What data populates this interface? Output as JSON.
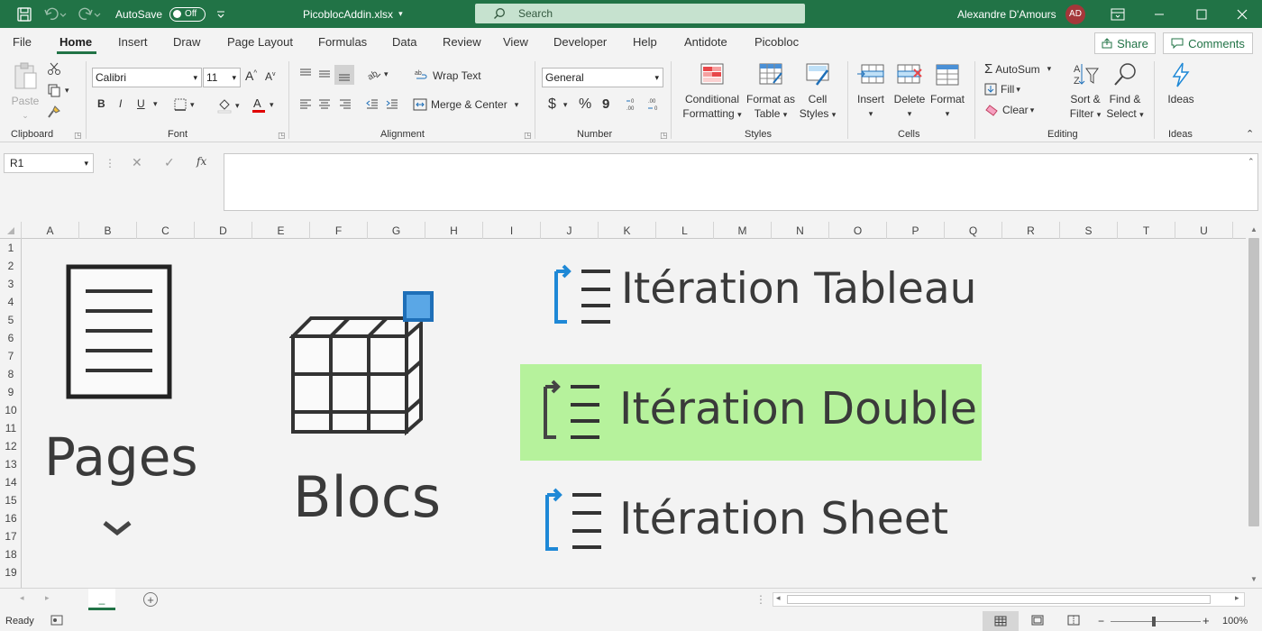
{
  "titlebar": {
    "autosave_label": "AutoSave",
    "autosave_state": "Off",
    "filename": "PicoblocAddin.xlsx",
    "search_placeholder": "Search",
    "user_name": "Alexandre D'Amours",
    "user_initials": "AD",
    "bg_color": "#217346"
  },
  "menu": {
    "items": [
      "File",
      "Home",
      "Insert",
      "Draw",
      "Page Layout",
      "Formulas",
      "Data",
      "Review",
      "View",
      "Developer",
      "Help",
      "Antidote",
      "Picobloc"
    ],
    "active": "Home",
    "share_label": "Share",
    "comments_label": "Comments"
  },
  "ribbon": {
    "clipboard": {
      "paste_label": "Paste",
      "group_label": "Clipboard"
    },
    "font": {
      "font_name": "Calibri",
      "font_size": "11",
      "bold": "B",
      "italic": "I",
      "underline": "U",
      "group_label": "Font"
    },
    "alignment": {
      "wrap_text": "Wrap Text",
      "merge_center": "Merge & Center",
      "group_label": "Alignment"
    },
    "number": {
      "format": "General",
      "currency": "$",
      "percent": "%",
      "comma": "9",
      "group_label": "Number"
    },
    "styles": {
      "conditional_1": "Conditional",
      "conditional_2": "Formatting",
      "format_table_1": "Format as",
      "format_table_2": "Table",
      "cell_styles_1": "Cell",
      "cell_styles_2": "Styles",
      "group_label": "Styles"
    },
    "cells": {
      "insert": "Insert",
      "delete": "Delete",
      "format": "Format",
      "group_label": "Cells"
    },
    "editing": {
      "autosum": "AutoSum",
      "fill": "Fill",
      "clear": "Clear",
      "sort_1": "Sort &",
      "sort_2": "Filter",
      "find_1": "Find &",
      "find_2": "Select",
      "group_label": "Editing"
    },
    "ideas": {
      "label": "Ideas",
      "group_label": "Ideas"
    }
  },
  "formula_bar": {
    "name_box": "R1",
    "formula": ""
  },
  "columns": [
    "A",
    "B",
    "C",
    "D",
    "E",
    "F",
    "G",
    "H",
    "I",
    "J",
    "K",
    "L",
    "M",
    "N",
    "O",
    "P",
    "Q",
    "R",
    "S",
    "T",
    "U"
  ],
  "rows": [
    "1",
    "2",
    "3",
    "4",
    "5",
    "6",
    "7",
    "8",
    "9",
    "10",
    "11",
    "12",
    "13",
    "14",
    "15",
    "16",
    "17",
    "18",
    "19"
  ],
  "sheet_content": {
    "pages_label": "Pages",
    "blocs_label": "Blocs",
    "iteration_tableau": "Itération Tableau",
    "iteration_double": "Itération Double",
    "iteration_sheet": "Itération Sheet",
    "highlight_color": "#b6f29c",
    "accent_blue": "#1e88d6"
  },
  "sheet_tabs": {
    "tab_label": "_"
  },
  "status": {
    "ready": "Ready",
    "zoom": "100%"
  }
}
